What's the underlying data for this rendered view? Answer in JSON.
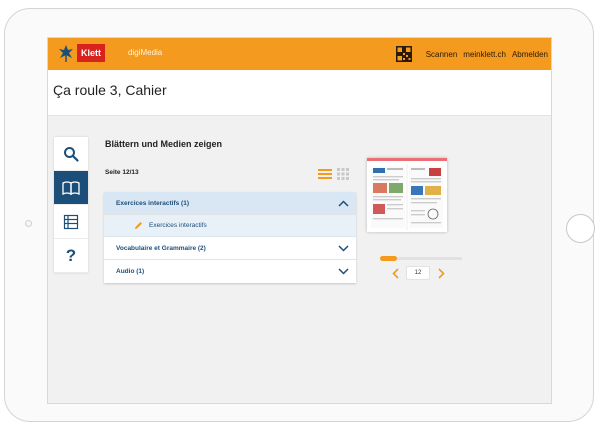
{
  "brand": {
    "logo_text": "Klett",
    "app_name": "digiMedia",
    "color_primary": "#f49a1f",
    "color_accent": "#1c4e7a",
    "color_logo": "#d8221e"
  },
  "topnav": {
    "scan_label": "Scannen",
    "site_label": "meinklett.ch",
    "logout_label": "Abmelden"
  },
  "page": {
    "title": "Ça roule 3, Cahier"
  },
  "sidebar": {
    "items": [
      {
        "icon": "search-icon",
        "active": false
      },
      {
        "icon": "book-icon",
        "active": true
      },
      {
        "icon": "list-icon",
        "active": false
      },
      {
        "icon": "help-icon",
        "label": "?",
        "active": false
      }
    ]
  },
  "main": {
    "heading": "Blättern und Medien zeigen",
    "page_label": "Seite 12/13",
    "sections": [
      {
        "label": "Exercices interactifs (1)",
        "expanded": true,
        "items": [
          {
            "label": "Exercices interactifs",
            "icon": "pencil-icon"
          }
        ]
      },
      {
        "label": "Vocabulaire et Grammaire (2)",
        "expanded": false
      },
      {
        "label": "Audio (1)",
        "expanded": false
      }
    ]
  },
  "preview": {
    "page_input": "12",
    "progress": 0.2
  }
}
